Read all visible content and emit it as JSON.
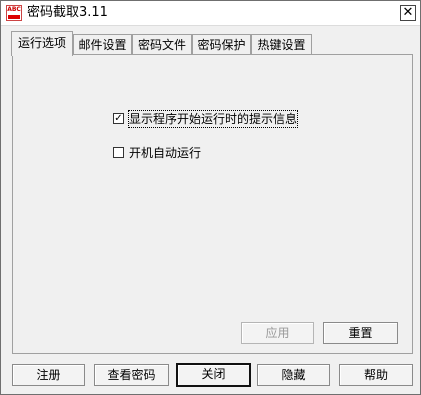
{
  "window": {
    "title": "密码截取3.11",
    "icon_text": "ABC"
  },
  "tabs": [
    {
      "label": "运行选项",
      "active": true
    },
    {
      "label": "邮件设置",
      "active": false
    },
    {
      "label": "密码文件",
      "active": false
    },
    {
      "label": "密码保护",
      "active": false
    },
    {
      "label": "热键设置",
      "active": false
    }
  ],
  "options": {
    "show_tip": {
      "label": "显示程序开始运行时的提示信息",
      "checked": true
    },
    "autostart": {
      "label": "开机自动运行",
      "checked": false
    }
  },
  "panel_buttons": {
    "apply": "应用",
    "reset": "重置"
  },
  "footer_buttons": {
    "register": "注册",
    "view_password": "查看密码",
    "close": "关闭",
    "hide": "隐藏",
    "help": "帮助"
  }
}
